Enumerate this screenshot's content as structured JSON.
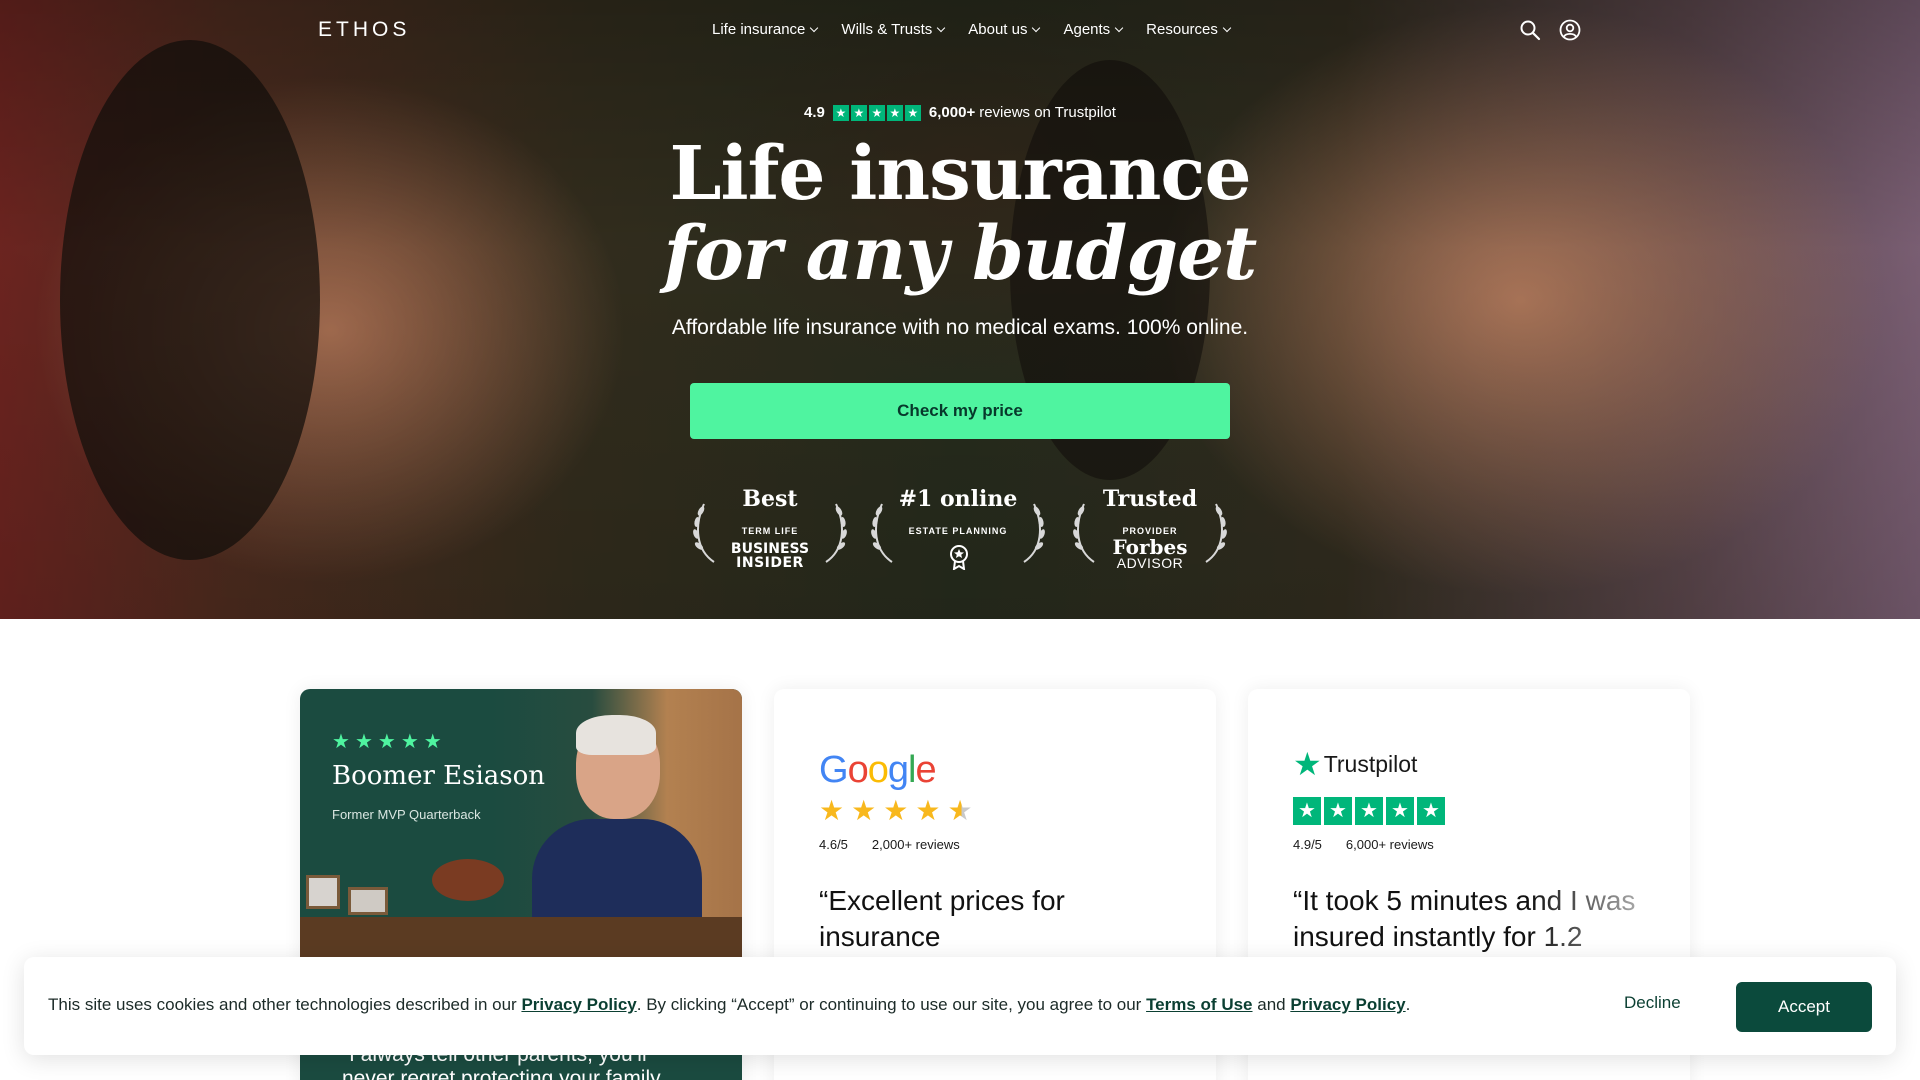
{
  "brand": {
    "logo_text": "ETHOS"
  },
  "nav": {
    "items": [
      {
        "label": "Life insurance"
      },
      {
        "label": "Wills & Trusts"
      },
      {
        "label": "About us"
      },
      {
        "label": "Agents"
      },
      {
        "label": "Resources"
      }
    ],
    "icons": [
      "search-icon",
      "account-icon"
    ]
  },
  "hero": {
    "rating_score": "4.9",
    "reviews_count": "6,000+",
    "reviews_text": "reviews on Trustpilot",
    "headline_line1": "Life insurance",
    "headline_line2": "for any budget",
    "subheadline": "Affordable life insurance with no medical exams. 100% online.",
    "cta_label": "Check my price",
    "awards": [
      {
        "title": "Best",
        "subtitle": "TERM LIFE",
        "brand": "BUSINESS",
        "brand2": "INSIDER"
      },
      {
        "title": "#1 online",
        "subtitle": "ESTATE PLANNING",
        "brand": "",
        "brand2": ""
      },
      {
        "title": "Trusted",
        "subtitle": "PROVIDER",
        "brand": "Forbes",
        "brand2": "ADVISOR"
      }
    ]
  },
  "testimonials": {
    "boomer": {
      "name": "Boomer Esiason",
      "role": "Former MVP Quarterback",
      "stars": 5,
      "quote": "“I always tell other parents, you’ll never regret protecting your family"
    },
    "google": {
      "logo": "Google",
      "score": "4.6/5",
      "reviews": "2,000+ reviews",
      "stars": 4.5,
      "quote": "“Excellent prices for insurance"
    },
    "trustpilot": {
      "logo": "Trustpilot",
      "score": "4.9/5",
      "reviews": "6,000+ reviews",
      "stars": 5,
      "quote": "“It took 5 minutes and I was insured instantly for 1.2"
    }
  },
  "cookie_banner": {
    "text_1": "This site uses cookies and other technologies described in our ",
    "privacy_link": "Privacy Policy",
    "text_2": ". By clicking “Accept” or continuing to use our site, you agree to our ",
    "terms_link": "Terms of Use",
    "text_3": " and ",
    "privacy_link_2": "Privacy Policy",
    "text_4": ".",
    "decline_label": "Decline",
    "accept_label": "Accept"
  },
  "colors": {
    "cta_green": "#4ff4a0",
    "brand_dark": "#0b4a3c",
    "trustpilot_green": "#00b67a",
    "google_star": "#f8b81d"
  }
}
